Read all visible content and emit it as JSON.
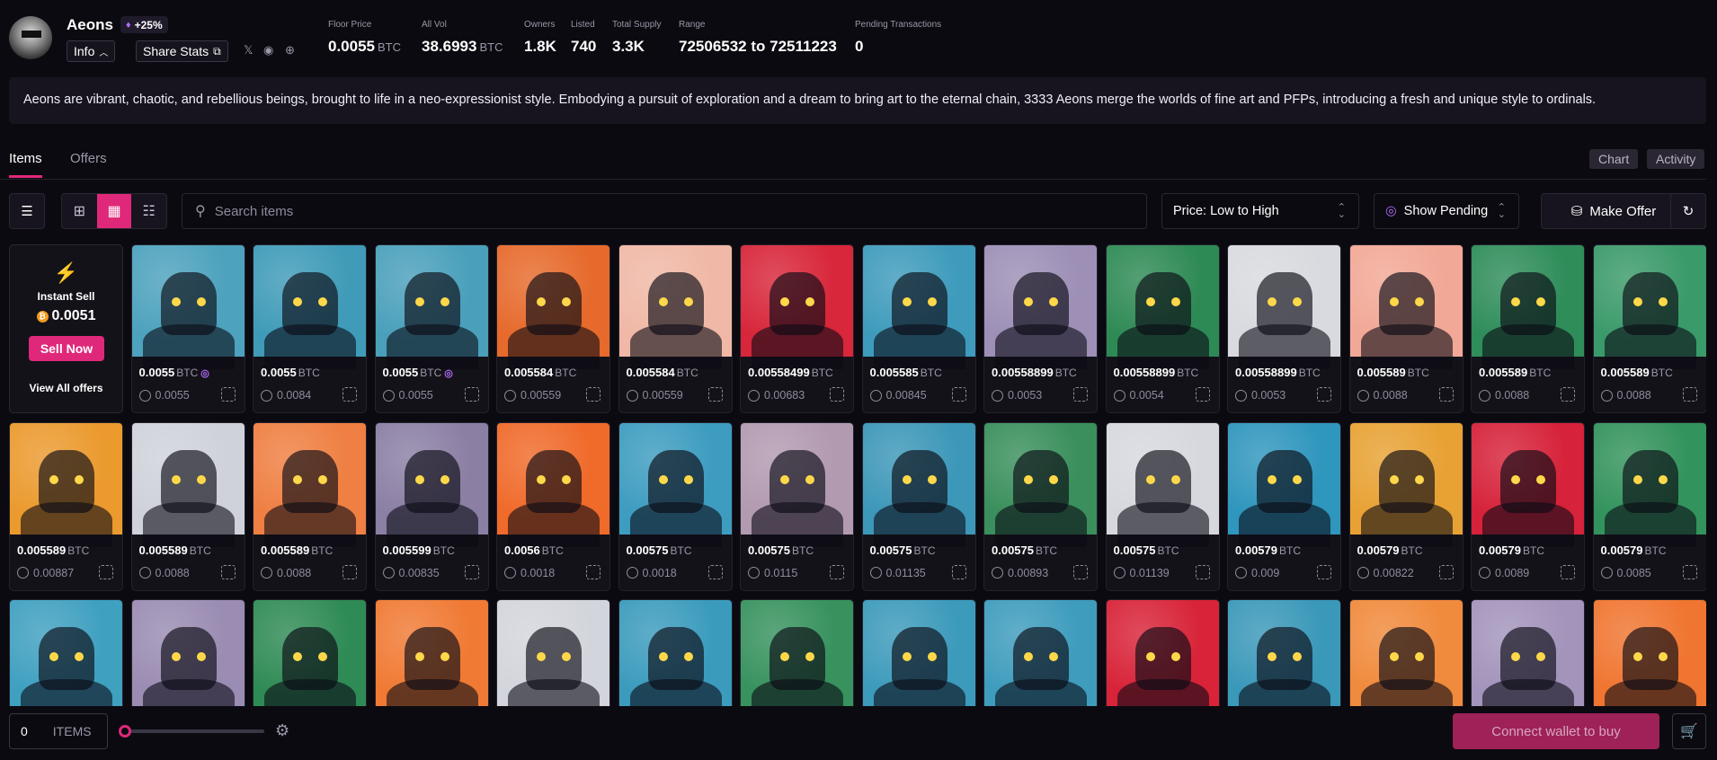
{
  "collection": {
    "name": "Aeons",
    "boost": "+25%",
    "info_label": "Info",
    "share_label": "Share Stats",
    "description": "Aeons are vibrant, chaotic, and rebellious beings, brought to life in a neo-expressionist style. Embodying a pursuit of exploration and a dream to bring art to the eternal chain, 3333 Aeons merge the worlds of fine art and PFPs, introducing a fresh and unique style to ordinals."
  },
  "stats": {
    "floor": {
      "label": "Floor Price",
      "value": "0.0055",
      "unit": "BTC"
    },
    "vol": {
      "label": "All Vol",
      "value": "38.6993",
      "unit": "BTC"
    },
    "owners": {
      "label": "Owners",
      "value": "1.8K"
    },
    "listed": {
      "label": "Listed",
      "value": "740"
    },
    "supply": {
      "label": "Total Supply",
      "value": "3.3K"
    },
    "range": {
      "label": "Range",
      "value": "72506532 to 72511223"
    },
    "pending": {
      "label": "Pending Transactions",
      "value": "0"
    }
  },
  "tabs": {
    "items": "Items",
    "offers": "Offers",
    "chart": "Chart",
    "activity": "Activity"
  },
  "toolbar": {
    "search_placeholder": "Search items",
    "sort": "Price: Low to High",
    "pending": "Show Pending",
    "make_offer": "Make Offer"
  },
  "instant_sell": {
    "title": "Instant Sell",
    "amount": "0.0051",
    "button": "Sell Now",
    "view_all": "View All offers"
  },
  "unit": "BTC",
  "cards": [
    {
      "price": "0.0055",
      "last": "0.0055",
      "bg": "#4da2bd",
      "marker": true
    },
    {
      "price": "0.0055",
      "last": "0.0084",
      "bg": "#3f9bb8"
    },
    {
      "price": "0.0055",
      "last": "0.0055",
      "bg": "#4aa0bb",
      "marker": true
    },
    {
      "price": "0.005584",
      "last": "0.00559",
      "bg": "#e66a2c"
    },
    {
      "price": "0.005584",
      "last": "0.00559",
      "bg": "#f0b8a6"
    },
    {
      "price": "0.00558499",
      "last": "0.00683",
      "bg": "#d8263a"
    },
    {
      "price": "0.005585",
      "last": "0.00845",
      "bg": "#3e9bbc"
    },
    {
      "price": "0.00558899",
      "last": "0.0053",
      "bg": "#9d8fb6"
    },
    {
      "price": "0.00558899",
      "last": "0.0054",
      "bg": "#2e8a55"
    },
    {
      "price": "0.00558899",
      "last": "0.0053",
      "bg": "#d9dadf"
    },
    {
      "price": "0.005589",
      "last": "0.0088",
      "bg": "#f2a896"
    },
    {
      "price": "0.005589",
      "last": "0.0088",
      "bg": "#2f8d5a"
    },
    {
      "price": "0.005589",
      "last": "0.0088",
      "bg": "#3b9a6a"
    },
    {
      "price": "0.005589",
      "last": "0.00887",
      "bg": "#eb9a2e"
    },
    {
      "price": "0.005589",
      "last": "0.0088",
      "bg": "#cfd2da"
    },
    {
      "price": "0.005589",
      "last": "0.0088",
      "bg": "#ef7f42"
    },
    {
      "price": "0.005599",
      "last": "0.00835",
      "bg": "#8b7fa4"
    },
    {
      "price": "0.0056",
      "last": "0.0018",
      "bg": "#f06a2a"
    },
    {
      "price": "0.00575",
      "last": "0.0018",
      "bg": "#3d9cc0"
    },
    {
      "price": "0.00575",
      "last": "0.0115",
      "bg": "#b29ab1"
    },
    {
      "price": "0.00575",
      "last": "0.01135",
      "bg": "#3c97b8"
    },
    {
      "price": "0.00575",
      "last": "0.00893",
      "bg": "#3a8f5c"
    },
    {
      "price": "0.00575",
      "last": "0.01139",
      "bg": "#d7d8de"
    },
    {
      "price": "0.00579",
      "last": "0.009",
      "bg": "#2f96bd"
    },
    {
      "price": "0.00579",
      "last": "0.00822",
      "bg": "#e8a234"
    },
    {
      "price": "0.00579",
      "last": "0.0089",
      "bg": "#d6223a"
    },
    {
      "price": "0.00579",
      "last": "0.0085",
      "bg": "#33935c"
    },
    {
      "price": "",
      "last": "",
      "bg": "#3fa0c0"
    },
    {
      "price": "",
      "last": "",
      "bg": "#9a8cb2"
    },
    {
      "price": "",
      "last": "",
      "bg": "#2f8b55"
    },
    {
      "price": "",
      "last": "",
      "bg": "#f07a34"
    },
    {
      "price": "",
      "last": "",
      "bg": "#d3d5dc"
    },
    {
      "price": "",
      "last": "",
      "bg": "#3b9bbd"
    },
    {
      "price": "",
      "last": "",
      "bg": "#37925e"
    },
    {
      "price": "",
      "last": "",
      "bg": "#3c9abb"
    },
    {
      "price": "",
      "last": "",
      "bg": "#3e9cbd"
    },
    {
      "price": "",
      "last": "",
      "bg": "#d82338"
    },
    {
      "price": "",
      "last": "",
      "bg": "#3a98b9"
    },
    {
      "price": "",
      "last": "",
      "bg": "#f08a3c"
    },
    {
      "price": "",
      "last": "",
      "bg": "#a394bb"
    },
    {
      "price": "",
      "last": "",
      "bg": "#f07530"
    }
  ],
  "footer": {
    "count": "0",
    "items_label": "ITEMS",
    "connect": "Connect wallet to buy"
  }
}
